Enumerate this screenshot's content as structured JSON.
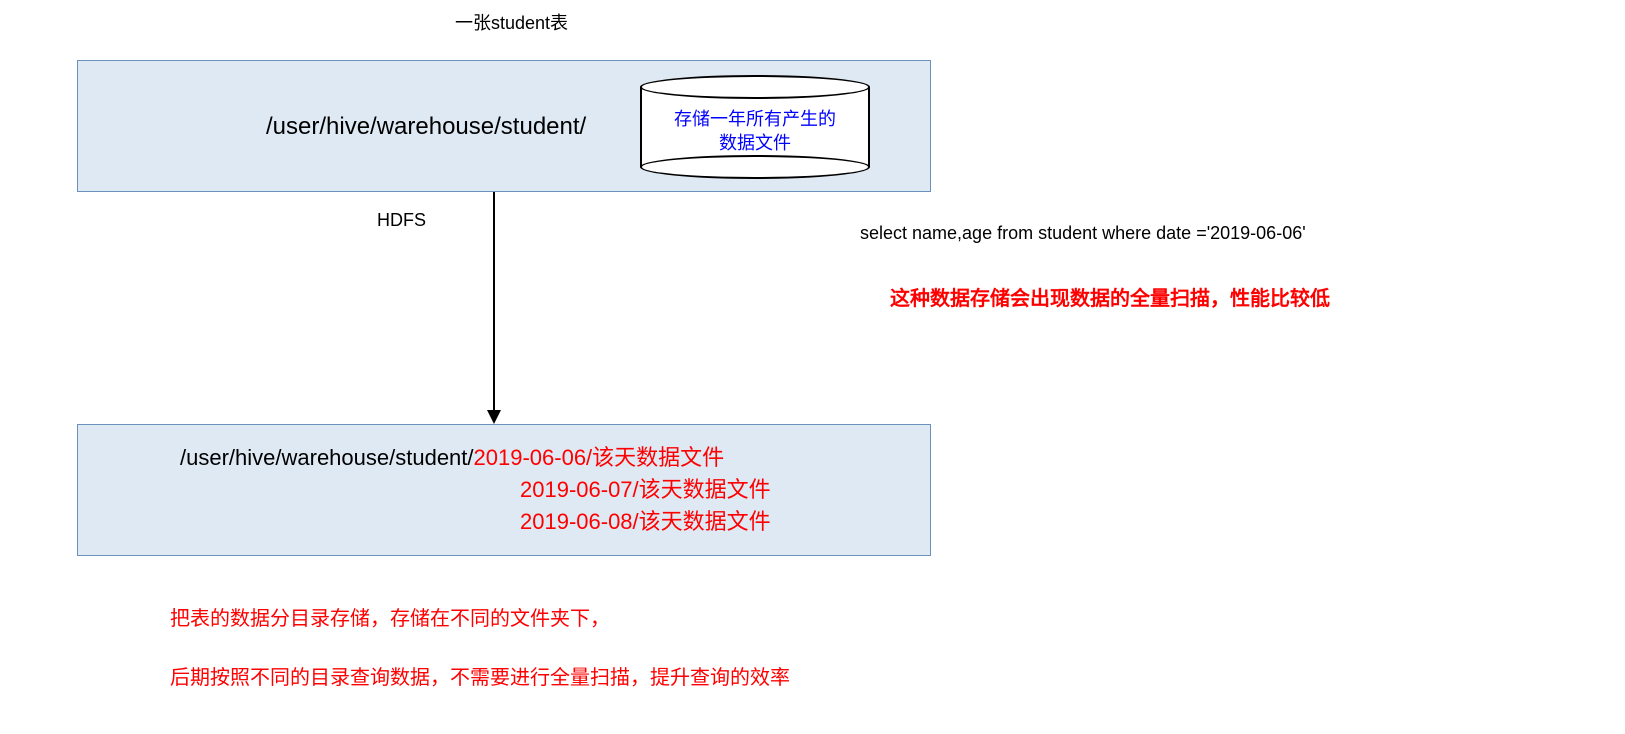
{
  "title": "一张student表",
  "box1": {
    "path": "/user/hive/warehouse/student/",
    "cylinder_line1": "存储一年所有产生的",
    "cylinder_line2": "数据文件"
  },
  "hdfs_label": "HDFS",
  "query": "select name,age from student where date ='2019-06-06'",
  "warning": "这种数据存储会出现数据的全量扫描，性能比较低",
  "box2": {
    "path_prefix": "/user/hive/warehouse/student/",
    "row1": "2019-06-06/该天数据文件",
    "row2": "2019-06-07/该天数据文件",
    "row3": "2019-06-08/该天数据文件"
  },
  "note1": "把表的数据分目录存储，存储在不同的文件夹下，",
  "note2": "后期按照不同的目录查询数据，不需要进行全量扫描，提升查询的效率"
}
